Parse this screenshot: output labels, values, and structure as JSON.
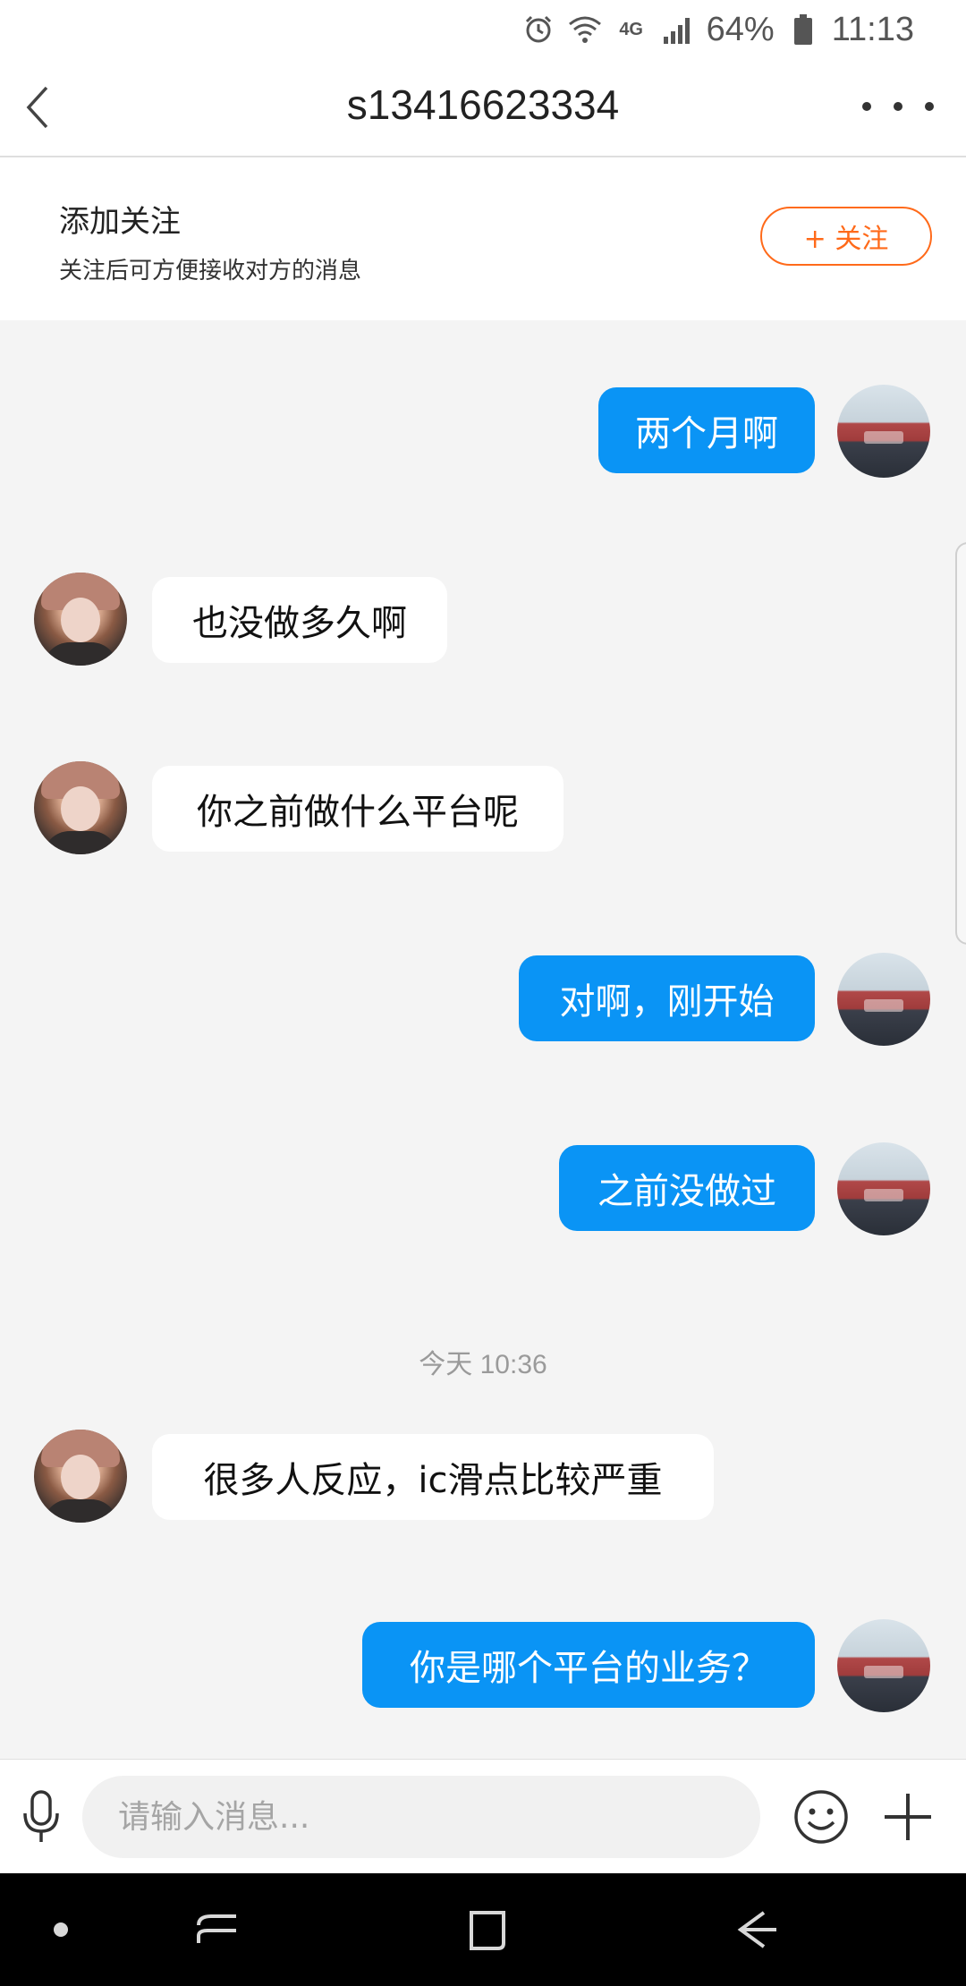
{
  "status_bar": {
    "network": "4G",
    "battery": "64%",
    "time": "11:13",
    "icons": [
      "alarm-icon",
      "wifi-icon",
      "network-4g-icon",
      "signal-icon",
      "battery-icon"
    ]
  },
  "header": {
    "title": "s13416623334",
    "back_icon": "chevron-left-icon",
    "more_icon": "more-dots-icon"
  },
  "follow_panel": {
    "title": "添加关注",
    "subtitle": "关注后可方便接收对方的消息",
    "button_label": "+ 关注"
  },
  "messages": [
    {
      "sender": "self",
      "text": "两个月啊"
    },
    {
      "sender": "other",
      "text": "也没做多久啊"
    },
    {
      "sender": "other",
      "text": "你之前做什么平台呢"
    },
    {
      "sender": "self",
      "text": "对啊，刚开始"
    },
    {
      "sender": "self",
      "text": "之前没做过"
    },
    {
      "sender": "other",
      "text": "很多人反应，ic滑点比较严重"
    },
    {
      "sender": "self",
      "text": "你是哪个平台的业务？"
    }
  ],
  "timestamp": "今天 10:36",
  "input_bar": {
    "placeholder": "请输入消息...",
    "icons": [
      "microphone-icon",
      "emoji-icon",
      "plus-icon"
    ]
  },
  "nav_bar": {
    "icons": [
      "nav-dot-icon",
      "recent-apps-icon",
      "home-icon",
      "back-icon"
    ]
  },
  "colors": {
    "self_bubble": "#0a94f5",
    "other_bubble": "#ffffff",
    "follow_accent": "#ff6a1a",
    "background": "#f4f4f4"
  }
}
